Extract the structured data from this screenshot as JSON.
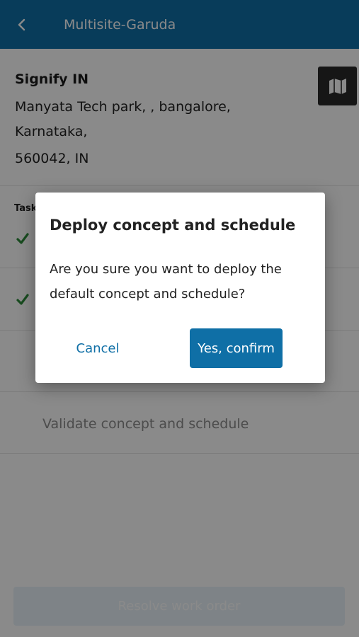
{
  "header": {
    "title": "Multisite-Garuda",
    "back_icon": "chevron-left-icon"
  },
  "site": {
    "name": "Signify IN",
    "address_line1": "Manyata Tech park, , bangalore,",
    "address_line2": "Karnataka,",
    "address_line3": "560042, IN",
    "map_icon": "map-icon"
  },
  "tasks": {
    "label": "Tasks",
    "items": [
      {
        "status": "done",
        "label": ""
      },
      {
        "status": "done",
        "label": ""
      },
      {
        "status": "pending",
        "label": ""
      },
      {
        "status": "pending",
        "label": "Validate concept and schedule"
      }
    ]
  },
  "footer": {
    "resolve_label": "Resolve work order"
  },
  "dialog": {
    "title": "Deploy concept and schedule",
    "message": "Are you sure you want to deploy the default concept and schedule?",
    "cancel_label": "Cancel",
    "confirm_label": "Yes, confirm"
  },
  "colors": {
    "brand": "#0f6fa6",
    "check": "#2e8b3a"
  }
}
